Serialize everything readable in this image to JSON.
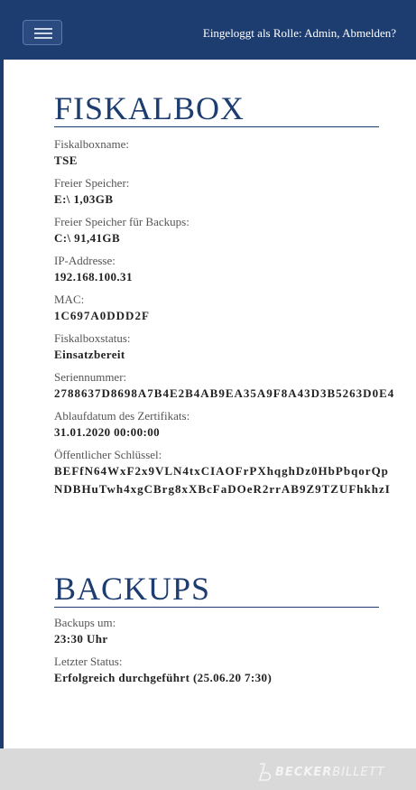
{
  "header": {
    "menu_icon": "hamburger-icon",
    "login_prefix": "Eingeloggt als Rolle: Admin, ",
    "logout_label": "Abmelden?"
  },
  "fiskalbox": {
    "title": "FISKALBOX",
    "fields": [
      {
        "label": "Fiskalboxname:",
        "value": "TSE"
      },
      {
        "label": "Freier Speicher:",
        "value": "E:\\ 1,03GB"
      },
      {
        "label": "Freier Speicher für Backups:",
        "value": "C:\\ 91,41GB"
      },
      {
        "label": "IP-Addresse:",
        "value": "192.168.100.31"
      },
      {
        "label": "MAC:",
        "value": "1C697A0DDD2F"
      },
      {
        "label": "Fiskalboxstatus:",
        "value": "Einsatzbereit"
      },
      {
        "label": "Seriennummer:",
        "value": "2788637D8698A7B4E2B4AB9EA35A9F8A43D3B5263D0E4"
      },
      {
        "label": "Ablaufdatum des Zertifikats:",
        "value": "31.01.2020 00:00:00"
      },
      {
        "label": "Öffentlicher Schlüssel:",
        "value": "BEFfN64WxF2x9VLN4txCIAOFrPXhqghDz0HbPbqorQp",
        "value2": "NDBHuTwh4xgCBrg8xXBcFaDOeR2rrAB9Z9TZUFhkhzI"
      }
    ]
  },
  "backups": {
    "title": "BACKUPS",
    "fields": [
      {
        "label": "Backups um:",
        "value": "23:30 Uhr"
      },
      {
        "label": "Letzter Status:",
        "value": "Erfolgreich durchgeführt (25.06.20 7:30)"
      }
    ]
  },
  "footer": {
    "logo_part1": "BECKER",
    "logo_part2": "BILLETT"
  },
  "colors": {
    "primary": "#1d3c70",
    "footer_bg": "#d9d9d9"
  }
}
